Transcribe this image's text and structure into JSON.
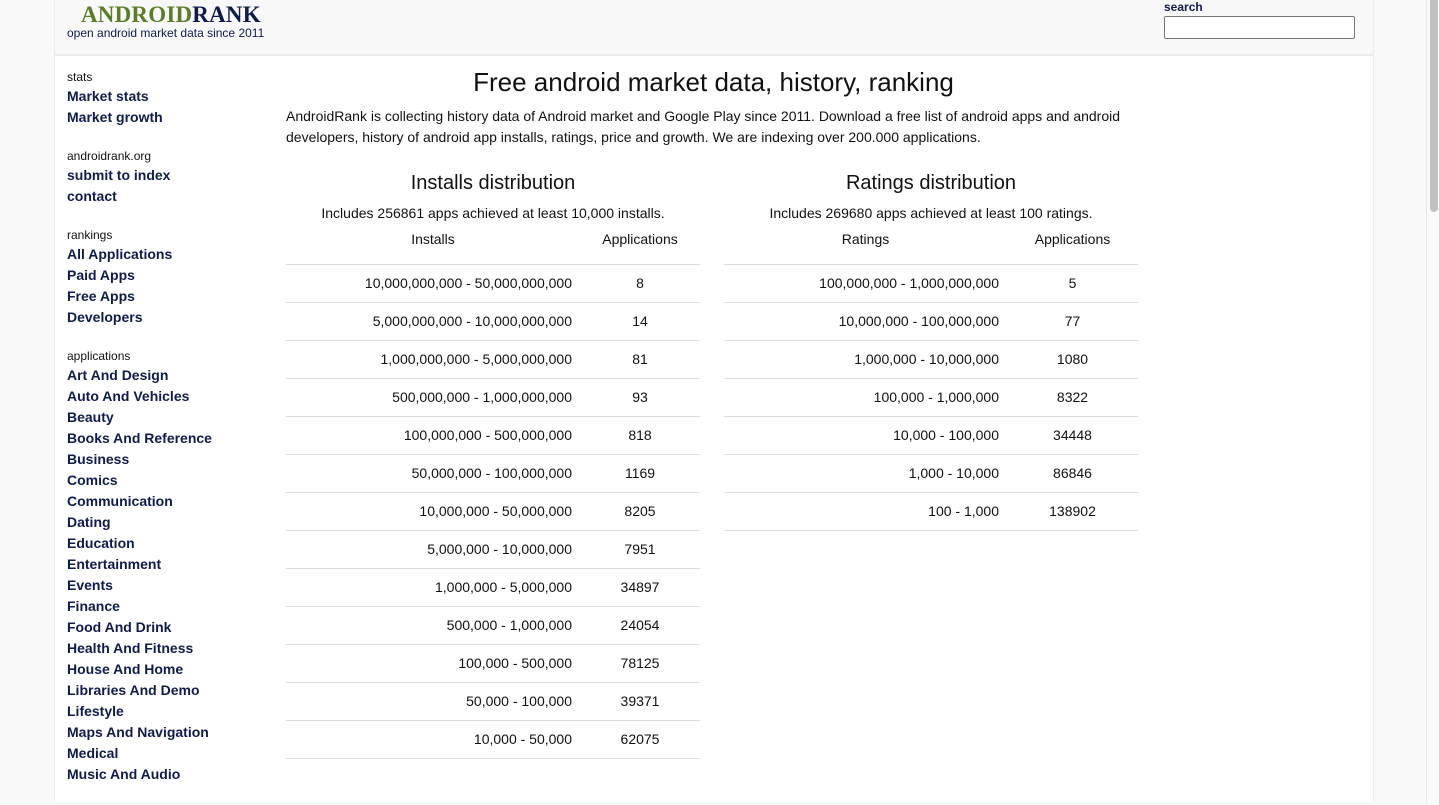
{
  "header": {
    "logo_part1": "ANDROID",
    "logo_part2": "RANK",
    "tagline": "open android market data since 2011",
    "search_label": "search",
    "search_value": "",
    "colors": {
      "logo_green": "#5b7d2a",
      "logo_navy": "#0f1b4a"
    }
  },
  "sidebar": {
    "groups": [
      {
        "heading": "stats",
        "items": [
          "Market stats",
          "Market growth"
        ]
      },
      {
        "heading": "androidrank.org",
        "items": [
          "submit to index",
          "contact"
        ]
      },
      {
        "heading": "rankings",
        "items": [
          "All Applications",
          "Paid Apps",
          "Free Apps",
          "Developers"
        ]
      },
      {
        "heading": "applications",
        "items": [
          "Art And Design",
          "Auto And Vehicles",
          "Beauty",
          "Books And Reference",
          "Business",
          "Comics",
          "Communication",
          "Dating",
          "Education",
          "Entertainment",
          "Events",
          "Finance",
          "Food And Drink",
          "Health And Fitness",
          "House And Home",
          "Libraries And Demo",
          "Lifestyle",
          "Maps And Navigation",
          "Medical",
          "Music And Audio"
        ]
      }
    ]
  },
  "main": {
    "title": "Free android market data, history, ranking",
    "intro": "AndroidRank is collecting history data of Android market and Google Play since 2011. Download a free list of android apps and android developers, history of android app installs, ratings, price and growth. We are indexing over 200.000 applications.",
    "installs": {
      "title": "Installs distribution",
      "subtitle": "Includes 256861 apps achieved at least 10,000 installs.",
      "col1": "Installs",
      "col2": "Applications",
      "rows": [
        [
          "10,000,000,000 - 50,000,000,000",
          "8"
        ],
        [
          "5,000,000,000 - 10,000,000,000",
          "14"
        ],
        [
          "1,000,000,000 - 5,000,000,000",
          "81"
        ],
        [
          "500,000,000 - 1,000,000,000",
          "93"
        ],
        [
          "100,000,000 - 500,000,000",
          "818"
        ],
        [
          "50,000,000 - 100,000,000",
          "1169"
        ],
        [
          "10,000,000 - 50,000,000",
          "8205"
        ],
        [
          "5,000,000 - 10,000,000",
          "7951"
        ],
        [
          "1,000,000 - 5,000,000",
          "34897"
        ],
        [
          "500,000 - 1,000,000",
          "24054"
        ],
        [
          "100,000 - 500,000",
          "78125"
        ],
        [
          "50,000 - 100,000",
          "39371"
        ],
        [
          "10,000 - 50,000",
          "62075"
        ]
      ]
    },
    "ratings": {
      "title": "Ratings distribution",
      "subtitle": "Includes 269680 apps achieved at least 100 ratings.",
      "col1": "Ratings",
      "col2": "Applications",
      "rows": [
        [
          "100,000,000 - 1,000,000,000",
          "5"
        ],
        [
          "10,000,000 - 100,000,000",
          "77"
        ],
        [
          "1,000,000 - 10,000,000",
          "1080"
        ],
        [
          "100,000 - 1,000,000",
          "8322"
        ],
        [
          "10,000 - 100,000",
          "34448"
        ],
        [
          "1,000 - 10,000",
          "86846"
        ],
        [
          "100 - 1,000",
          "138902"
        ]
      ]
    }
  }
}
